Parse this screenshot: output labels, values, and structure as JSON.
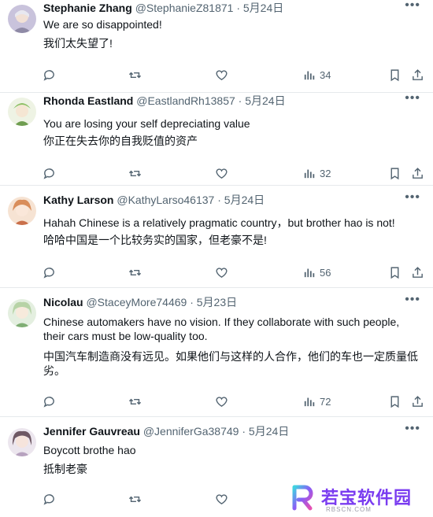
{
  "tweets": [
    {
      "name": "Stephanie Zhang",
      "handle": "@StephanieZ81871",
      "date": "5月24日",
      "lines": [
        "We are so disappointed!",
        "我们太失望了!"
      ],
      "views": "34",
      "avatar_color": "#c9c3dc"
    },
    {
      "name": "Rhonda Eastland",
      "handle": "@EastlandRh13857",
      "date": "5月24日",
      "lines": [
        "You are losing your self depreciating value",
        "你正在失去你的自我贬值的资产"
      ],
      "views": "32",
      "avatar_color": "#b9d39a"
    },
    {
      "name": "Kathy Larson",
      "handle": "@KathyLarso46137",
      "date": "5月24日",
      "lines": [
        "Hahah Chinese is a relatively pragmatic country，but brother hao is not!",
        "哈哈中国是一个比较务实的国家，但老豪不是!"
      ],
      "views": "56",
      "avatar_color": "#e7b58f"
    },
    {
      "name": "Nicolau",
      "handle": "@StaceyMore74469",
      "date": "5月23日",
      "lines": [
        "Chinese automakers have no vision. If they collaborate with such people,",
        "their cars must be low-quality too.",
        "中国汽车制造商没有远见。如果他们与这样的人合作，他们的车也一定质量低",
        "劣。"
      ],
      "views": "72",
      "avatar_color": "#a8cfa2"
    },
    {
      "name": "Jennifer Gauvreau",
      "handle": "@JenniferGa38749",
      "date": "5月24日",
      "lines": [
        "Boycott brothe hao",
        "抵制老豪"
      ],
      "views": "",
      "avatar_color": "#cfc6d6"
    }
  ],
  "separator": " · ",
  "icons": {
    "reply": "reply-icon",
    "retweet": "retweet-icon",
    "like": "like-icon",
    "views": "views-icon",
    "bookmark": "bookmark-icon",
    "share": "share-icon",
    "more": "more-icon"
  },
  "watermark": {
    "text": "若宝软件园",
    "sub": "RBSCN.COM",
    "color": "#7a3cf0"
  }
}
